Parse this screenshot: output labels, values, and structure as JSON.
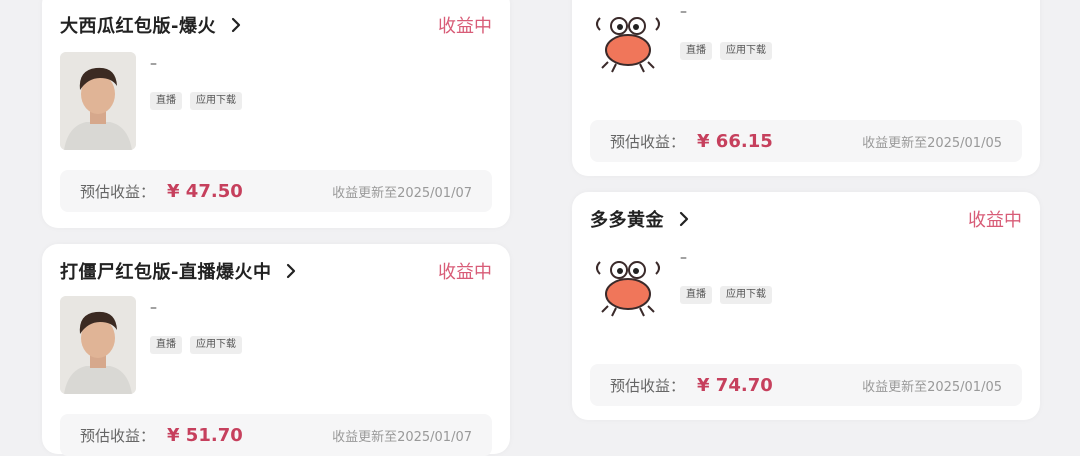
{
  "colors": {
    "accent": "#d85c77",
    "value": "#c6405d",
    "background": "#f1f1f3"
  },
  "left_cards": [
    {
      "title": "大西瓜红包版-爆火",
      "status": "收益中",
      "dash": "–",
      "tags": [
        "直播",
        "应用下载"
      ],
      "earn_label": "预估收益：",
      "earn_value": "¥ 47.50",
      "update": "收益更新至2025/01/07",
      "avatar": "person-photo"
    },
    {
      "title": "打僵尸红包版-直播爆火中",
      "status": "收益中",
      "dash": "–",
      "tags": [
        "直播",
        "应用下载"
      ],
      "earn_label": "预估收益：",
      "earn_value": "¥ 51.70",
      "update": "收益更新至2025/01/07",
      "avatar": "person-photo"
    }
  ],
  "right_cards": [
    {
      "title": "",
      "status": "",
      "dash": "–",
      "tags": [
        "直播",
        "应用下载"
      ],
      "earn_label": "预估收益：",
      "earn_value": "¥ 66.15",
      "update": "收益更新至2025/01/05",
      "avatar": "crab-mascot"
    },
    {
      "title": "多多黄金",
      "status": "收益中",
      "dash": "–",
      "tags": [
        "直播",
        "应用下载"
      ],
      "earn_label": "预估收益：",
      "earn_value": "¥ 74.70",
      "update": "收益更新至2025/01/05",
      "avatar": "crab-mascot"
    }
  ]
}
